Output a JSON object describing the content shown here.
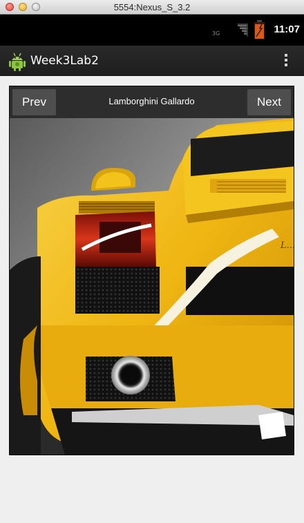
{
  "window": {
    "title": "5554:Nexus_S_3.2"
  },
  "status_bar": {
    "network": "3G",
    "time": "11:07",
    "icons": [
      "signal-icon",
      "battery-icon"
    ]
  },
  "action_bar": {
    "app_name": "Week3Lab2",
    "icons": [
      "android-app-icon",
      "overflow-menu-icon"
    ]
  },
  "gallery": {
    "prev_label": "Prev",
    "next_label": "Next",
    "caption": "Lamborghini Gallardo",
    "photo": {
      "subject": "yellow Lamborghini Gallardo rear view",
      "badge_text": "L..."
    }
  },
  "colors": {
    "car_yellow": "#f2c21a",
    "bar_bg": "#2d2d2d",
    "button_bg": "#4e4e4e"
  }
}
